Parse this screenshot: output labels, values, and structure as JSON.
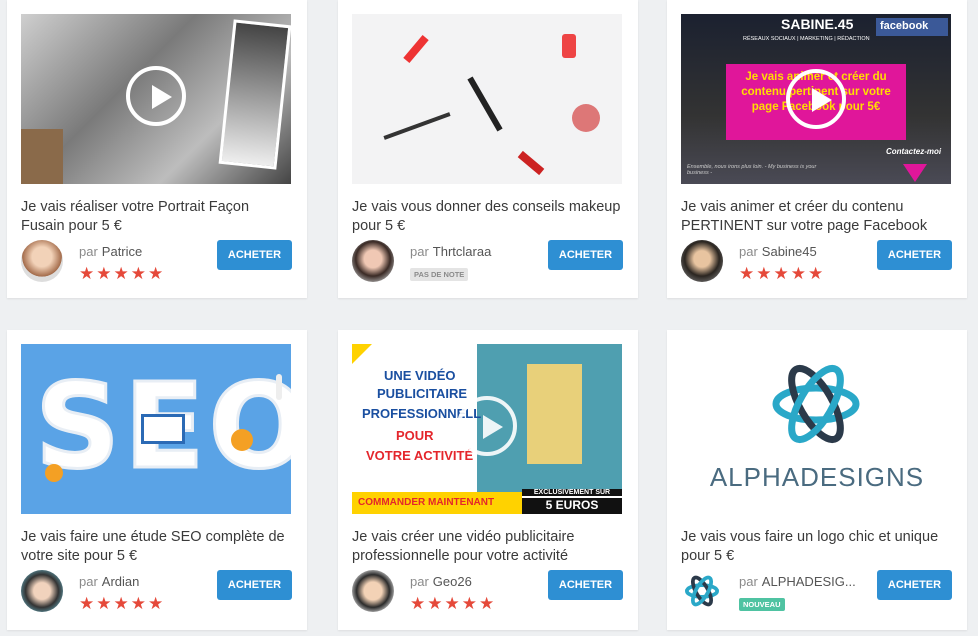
{
  "buy_label": "ACHETER",
  "by_label": "par",
  "colors": {
    "button": "#2e8fd3",
    "stars": "#e5493a",
    "new_badge": "#4fc3a2"
  },
  "cards": [
    {
      "title": "Je vais réaliser votre Portrait Façon Fusain pour 5 €",
      "seller": "Patrice",
      "rating": 5,
      "stars": "★★★★★",
      "thumb": "charcoal-portrait-video"
    },
    {
      "title": "Je vais vous donner des conseils makeup pour 5 €",
      "seller": "Thrtclaraa",
      "rating": null,
      "badge": "PAS DE NOTE",
      "thumb": "makeup-products"
    },
    {
      "title": "Je vais animer et créer du contenu PERTINENT sur votre page Facebook",
      "seller": "Sabine45",
      "rating": 5,
      "stars": "★★★★★",
      "thumb": "facebook-promo-video",
      "thumb_text": {
        "brand": "SABINE.45",
        "menu": "RÉSEAUX SOCIAUX | MARKETING | RÉDACTION",
        "facebook": "facebook",
        "pitch": "Je vais animer et créer du contenu pertinent sur votre page Facebook pour 5€",
        "contact": "Contactez-moi",
        "tagline": "Ensemble, nous irons plus loin. - My business is your business -"
      }
    },
    {
      "title": "Je vais faire une étude SEO complète de votre site pour 5 €",
      "seller": "Ardian",
      "rating": 5,
      "stars": "★★★★★",
      "thumb": "seo-illustration",
      "thumb_text": {
        "word": "SEO"
      }
    },
    {
      "title": "Je vais créer une vidéo publicitaire professionnelle pour votre activité",
      "seller": "Geo26",
      "rating": 5,
      "stars": "★★★★★",
      "thumb": "video-ad-promo",
      "thumb_text": {
        "l1": "UNE VIDÉO",
        "l2": "PUBLICITAIRE",
        "l3": "PROFESSIONNELL",
        "l4": "POUR",
        "l5": "VOTRE ACTIVITÉ",
        "cta": "COMMANDER MAINTENANT",
        "excl": "EXCLUSIVEMENT SUR",
        "price": "5 EUROS"
      }
    },
    {
      "title": "Je vais vous faire un logo chic et unique pour 5 €",
      "seller": "ALPHADESIG...",
      "rating": null,
      "badge": "NOUVEAU",
      "thumb": "alphadesigns-logo",
      "thumb_text": {
        "logo": "ALPHADESIGNS"
      }
    }
  ]
}
